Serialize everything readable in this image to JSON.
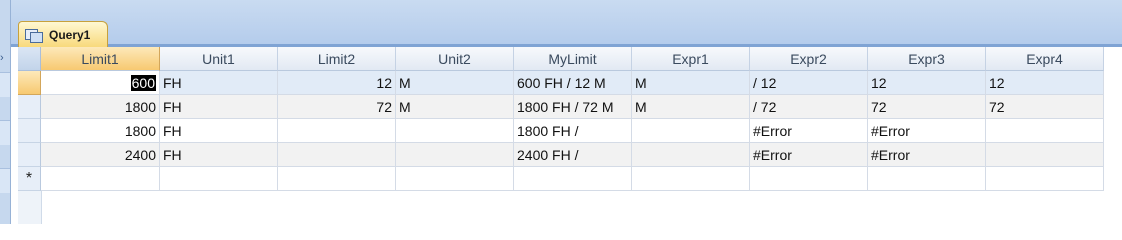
{
  "window": {
    "tab_title": "Query1"
  },
  "grid": {
    "columns": [
      "Limit1",
      "Unit1",
      "Limit2",
      "Unit2",
      "MyLimit",
      "Expr1",
      "Expr2",
      "Expr3",
      "Expr4"
    ],
    "rows": [
      [
        "600",
        "FH",
        "12",
        "M",
        "600 FH / 12 M",
        "M",
        " / 12",
        "12",
        "12"
      ],
      [
        "1800",
        "FH",
        "72",
        "M",
        "1800 FH / 72 M",
        "M",
        " / 72",
        "72",
        "72"
      ],
      [
        "1800",
        "FH",
        "",
        "",
        "1800 FH /",
        "",
        "#Error",
        "#Error",
        ""
      ],
      [
        "2400",
        "FH",
        "",
        "",
        "2400 FH /",
        "",
        "#Error",
        "#Error",
        ""
      ]
    ],
    "new_record_marker": "*"
  },
  "icons": {
    "tab_icon": "query-datasheet-icon",
    "new_record": "asterisk-icon"
  }
}
